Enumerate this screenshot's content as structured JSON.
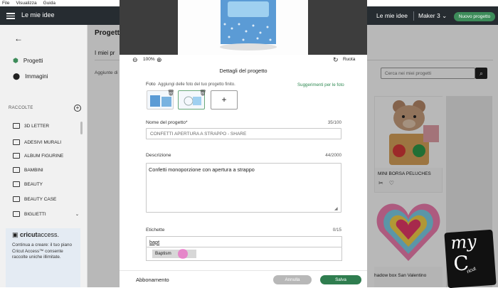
{
  "os_menu": [
    "File",
    "Visualizza",
    "Guida"
  ],
  "topbar": {
    "brand": "Le mie idee",
    "my_ideas": "Le mie idee",
    "machine": "Maker 3",
    "new_project": "Nuovo progetto"
  },
  "sidebar": {
    "nav": [
      {
        "label": "Progetti"
      },
      {
        "label": "Immagini"
      }
    ],
    "collections_header": "RACCOLTE",
    "folders": [
      "3D LETTER",
      "ADESIVI MURALI",
      "ALBUM FIGURINE",
      "BAMBINI",
      "BEAUTY",
      "BEAUTY CASE",
      "BIGLIETTI"
    ],
    "access": {
      "logo": "cricut",
      "logo_suffix": "access.",
      "text": "Continua a creare: il tuo piano Cricut Access™ consente raccolte uniche illimitate."
    }
  },
  "main": {
    "title": "Progetti",
    "tab": "I miei pr",
    "add_label": "Aggiunte di",
    "search_placeholder": "Cerca nei miei progetti",
    "cards": [
      {
        "title": "MINI BORSA PELUCHES"
      },
      {
        "title": "hadow box San Valentino"
      }
    ]
  },
  "modal": {
    "zoom": "100%",
    "rotate": "Ruota",
    "title": "Dettagli del progetto",
    "photo": {
      "label": "Foto",
      "hint": "Aggiungi delle foto del tuo progetto finito.",
      "suggestions_link": "Suggerimenti per le foto"
    },
    "name": {
      "label": "Nome del progetto*",
      "counter": "35/100",
      "value": "CONFETTI APERTURA A STRAPPO - SHARE"
    },
    "description": {
      "label": "Descrizione",
      "counter": "44/2000",
      "value": "Confetti monoporzione con apertura a strappo"
    },
    "tags": {
      "label": "Etichette",
      "counter": "0/15",
      "value": "bapt",
      "suggestion": "Baptism"
    },
    "footer": {
      "subscription": "Abbonamento",
      "cancel": "Annulla",
      "save": "Salva"
    }
  },
  "watermark": "myCricut",
  "colors": {
    "topbar": "#262c31",
    "accent_green": "#2f7d4f",
    "cancel_grey": "#b8b8b8",
    "cursor_pink": "#f046be"
  }
}
